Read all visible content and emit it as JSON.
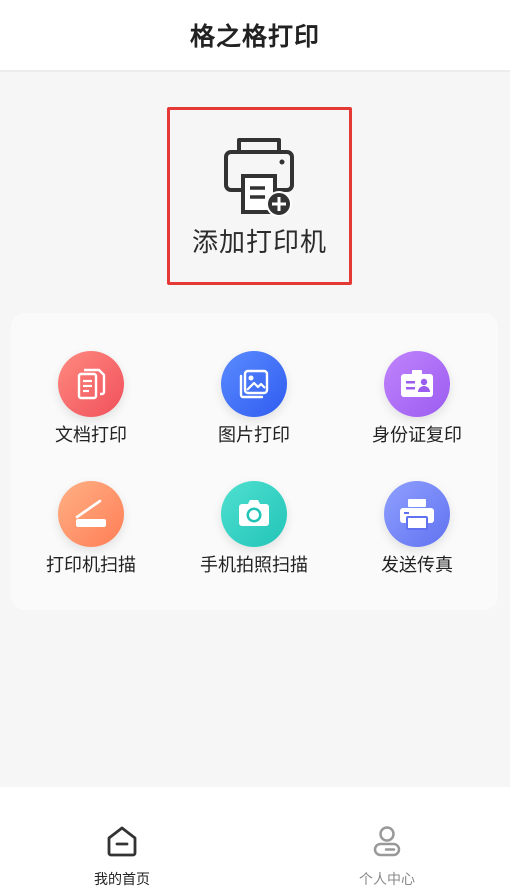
{
  "header": {
    "title": "格之格打印"
  },
  "add_printer": {
    "label": "添加打印机",
    "icon": "printer-add-icon",
    "highlight_color": "#e53935"
  },
  "functions": [
    {
      "id": "doc-print",
      "label": "文档打印",
      "icon": "document-icon",
      "colors": [
        "#ff8a80",
        "#f0505b"
      ]
    },
    {
      "id": "photo-print",
      "label": "图片打印",
      "icon": "image-icon",
      "colors": [
        "#5b8bff",
        "#2f5cf0"
      ]
    },
    {
      "id": "id-copy",
      "label": "身份证复印",
      "icon": "id-card-icon",
      "colors": [
        "#c084fc",
        "#9b5cf0"
      ]
    },
    {
      "id": "printer-scan",
      "label": "打印机扫描",
      "icon": "scanner-icon",
      "colors": [
        "#ffb085",
        "#ff7e56"
      ]
    },
    {
      "id": "phone-scan",
      "label": "手机拍照扫描",
      "icon": "camera-icon",
      "colors": [
        "#4fe0d0",
        "#22c4b8"
      ]
    },
    {
      "id": "fax",
      "label": "发送传真",
      "icon": "fax-printer-icon",
      "colors": [
        "#8fa0ff",
        "#6172f0"
      ]
    }
  ],
  "tabbar": {
    "items": [
      {
        "label": "我的首页",
        "icon": "home-icon",
        "active": true,
        "color": "#222222"
      },
      {
        "label": "个人中心",
        "icon": "user-icon",
        "active": false,
        "color": "#8a8a8a"
      }
    ]
  }
}
